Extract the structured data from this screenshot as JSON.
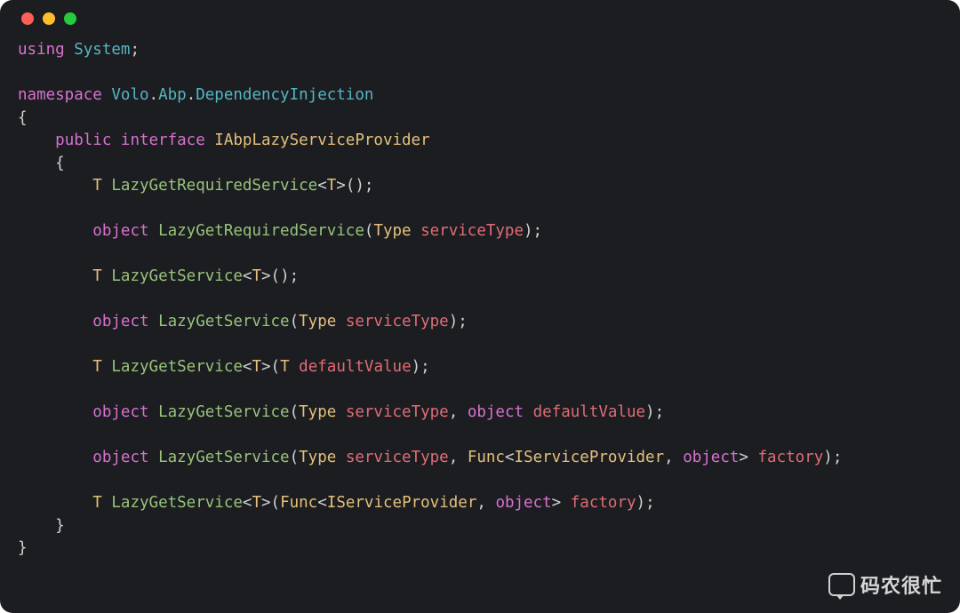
{
  "colors": {
    "window_bg": "#1b1d21",
    "dot_red": "#ff5f56",
    "dot_yellow": "#ffbd2e",
    "dot_green": "#27c93f",
    "keyword": "#d971d0",
    "namespace": "#56b6c2",
    "type": "#e5c07b",
    "method": "#98c379",
    "param": "#e06c75",
    "punct": "#d1d1d1"
  },
  "watermark": {
    "text": "码农很忙",
    "icon": "wechat-bubble-icon"
  },
  "code": {
    "language": "csharp",
    "lines_html": [
      "<span class='k'>using</span> <span class='ns'>System</span><span class='semi'>;</span>",
      "",
      "<span class='k'>namespace</span> <span class='ns'>Volo</span><span class='pn'>.</span><span class='ns'>Abp</span><span class='pn'>.</span><span class='ns'>DependencyInjection</span>",
      "<span class='pn'>{</span>",
      "    <span class='k'>public</span> <span class='k'>interface</span> <span class='ty'>IAbpLazyServiceProvider</span>",
      "    <span class='pn'>{</span>",
      "        <span class='ty'>T</span> <span class='fn'>LazyGetRequiredService</span><span class='pn'>&lt;</span><span class='ty'>T</span><span class='pn'>&gt;();</span>",
      "",
      "        <span class='k'>object</span> <span class='fn'>LazyGetRequiredService</span><span class='pn'>(</span><span class='ty'>Type</span> <span class='pm'>serviceType</span><span class='pn'>);</span>",
      "",
      "        <span class='ty'>T</span> <span class='fn'>LazyGetService</span><span class='pn'>&lt;</span><span class='ty'>T</span><span class='pn'>&gt;();</span>",
      "",
      "        <span class='k'>object</span> <span class='fn'>LazyGetService</span><span class='pn'>(</span><span class='ty'>Type</span> <span class='pm'>serviceType</span><span class='pn'>);</span>",
      "",
      "        <span class='ty'>T</span> <span class='fn'>LazyGetService</span><span class='pn'>&lt;</span><span class='ty'>T</span><span class='pn'>&gt;(</span><span class='ty'>T</span> <span class='pm'>defaultValue</span><span class='pn'>);</span>",
      "",
      "        <span class='k'>object</span> <span class='fn'>LazyGetService</span><span class='pn'>(</span><span class='ty'>Type</span> <span class='pm'>serviceType</span><span class='pn'>,</span> <span class='k'>object</span> <span class='pm'>defaultValue</span><span class='pn'>);</span>",
      "",
      "        <span class='k'>object</span> <span class='fn'>LazyGetService</span><span class='pn'>(</span><span class='ty'>Type</span> <span class='pm'>serviceType</span><span class='pn'>,</span> <span class='ty'>Func</span><span class='pn'>&lt;</span><span class='ty'>IServiceProvider</span><span class='pn'>,</span> <span class='k'>object</span><span class='pn'>&gt;</span> <span class='pm'>factory</span><span class='pn'>);</span>",
      "",
      "        <span class='ty'>T</span> <span class='fn'>LazyGetService</span><span class='pn'>&lt;</span><span class='ty'>T</span><span class='pn'>&gt;(</span><span class='ty'>Func</span><span class='pn'>&lt;</span><span class='ty'>IServiceProvider</span><span class='pn'>,</span> <span class='k'>object</span><span class='pn'>&gt;</span> <span class='pm'>factory</span><span class='pn'>);</span>",
      "    <span class='pn'>}</span>",
      "<span class='pn'>}</span>"
    ],
    "plain_lines": [
      "using System;",
      "",
      "namespace Volo.Abp.DependencyInjection",
      "{",
      "    public interface IAbpLazyServiceProvider",
      "    {",
      "        T LazyGetRequiredService<T>();",
      "",
      "        object LazyGetRequiredService(Type serviceType);",
      "",
      "        T LazyGetService<T>();",
      "",
      "        object LazyGetService(Type serviceType);",
      "",
      "        T LazyGetService<T>(T defaultValue);",
      "",
      "        object LazyGetService(Type serviceType, object defaultValue);",
      "",
      "        object LazyGetService(Type serviceType, Func<IServiceProvider, object> factory);",
      "",
      "        T LazyGetService<T>(Func<IServiceProvider, object> factory);",
      "    }",
      "}"
    ]
  }
}
